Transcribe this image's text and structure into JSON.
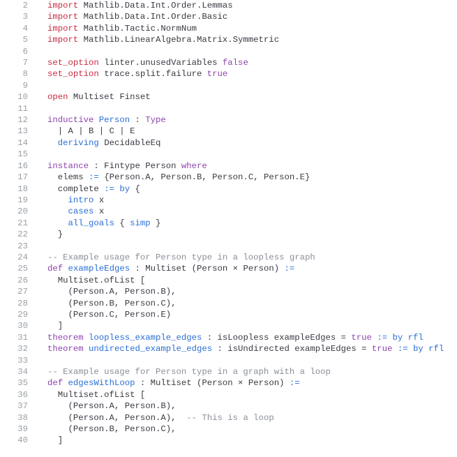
{
  "lines": [
    {
      "n": 2,
      "segs": [
        [
          "kw-import",
          "import "
        ],
        [
          "plain",
          "Mathlib.Data.Int.Order.Lemmas"
        ]
      ]
    },
    {
      "n": 3,
      "segs": [
        [
          "kw-import",
          "import "
        ],
        [
          "plain",
          "Mathlib.Data.Int.Order.Basic"
        ]
      ]
    },
    {
      "n": 4,
      "segs": [
        [
          "kw-import",
          "import "
        ],
        [
          "plain",
          "Mathlib.Tactic.NormNum"
        ]
      ]
    },
    {
      "n": 5,
      "segs": [
        [
          "kw-import",
          "import "
        ],
        [
          "plain",
          "Mathlib.LinearAlgebra.Matrix.Symmetric"
        ]
      ]
    },
    {
      "n": 6,
      "segs": [
        [
          "plain",
          ""
        ]
      ]
    },
    {
      "n": 7,
      "segs": [
        [
          "kw-import",
          "set_option "
        ],
        [
          "plain",
          "linter.unusedVariables "
        ],
        [
          "kw-purple",
          "false"
        ]
      ]
    },
    {
      "n": 8,
      "segs": [
        [
          "kw-import",
          "set_option "
        ],
        [
          "plain",
          "trace.split.failure "
        ],
        [
          "kw-purple",
          "true"
        ]
      ]
    },
    {
      "n": 9,
      "segs": [
        [
          "plain",
          ""
        ]
      ]
    },
    {
      "n": 10,
      "segs": [
        [
          "kw-import",
          "open "
        ],
        [
          "plain",
          "Multiset Finset"
        ]
      ]
    },
    {
      "n": 11,
      "segs": [
        [
          "plain",
          ""
        ]
      ]
    },
    {
      "n": 12,
      "segs": [
        [
          "kw-purple",
          "inductive "
        ],
        [
          "kw-blue",
          "Person"
        ],
        [
          "plain",
          " : "
        ],
        [
          "kw-purple",
          "Type"
        ]
      ]
    },
    {
      "n": 13,
      "segs": [
        [
          "plain",
          "  | A | B | C | E"
        ]
      ]
    },
    {
      "n": 14,
      "segs": [
        [
          "plain",
          "  "
        ],
        [
          "kw-blue",
          "deriving "
        ],
        [
          "plain",
          "DecidableEq"
        ]
      ]
    },
    {
      "n": 15,
      "segs": [
        [
          "plain",
          ""
        ]
      ]
    },
    {
      "n": 16,
      "segs": [
        [
          "kw-purple",
          "instance"
        ],
        [
          "plain",
          " : Fintype Person "
        ],
        [
          "kw-purple",
          "where"
        ]
      ]
    },
    {
      "n": 17,
      "segs": [
        [
          "plain",
          "  elems "
        ],
        [
          "kw-blue",
          ":="
        ],
        [
          "plain",
          " {Person.A, Person.B, Person.C, Person.E}"
        ]
      ]
    },
    {
      "n": 18,
      "segs": [
        [
          "plain",
          "  complete "
        ],
        [
          "kw-blue",
          ":= by"
        ],
        [
          "plain",
          " {"
        ]
      ]
    },
    {
      "n": 19,
      "segs": [
        [
          "plain",
          "    "
        ],
        [
          "kw-blue",
          "intro"
        ],
        [
          "plain",
          " x"
        ]
      ]
    },
    {
      "n": 20,
      "segs": [
        [
          "plain",
          "    "
        ],
        [
          "kw-blue",
          "cases"
        ],
        [
          "plain",
          " x"
        ]
      ]
    },
    {
      "n": 21,
      "segs": [
        [
          "plain",
          "    "
        ],
        [
          "kw-blue",
          "all_goals"
        ],
        [
          "plain",
          " { "
        ],
        [
          "kw-blue",
          "simp"
        ],
        [
          "plain",
          " }"
        ]
      ]
    },
    {
      "n": 22,
      "segs": [
        [
          "plain",
          "  }"
        ]
      ]
    },
    {
      "n": 23,
      "segs": [
        [
          "plain",
          ""
        ]
      ]
    },
    {
      "n": 24,
      "segs": [
        [
          "comment",
          "-- Example usage for Person type in a loopless graph"
        ]
      ]
    },
    {
      "n": 25,
      "segs": [
        [
          "kw-purple",
          "def "
        ],
        [
          "kw-blue",
          "exampleEdges"
        ],
        [
          "plain",
          " : Multiset (Person × Person) "
        ],
        [
          "kw-blue",
          ":="
        ]
      ]
    },
    {
      "n": 26,
      "segs": [
        [
          "plain",
          "  Multiset.ofList ["
        ]
      ]
    },
    {
      "n": 27,
      "segs": [
        [
          "plain",
          "    (Person.A, Person.B),"
        ]
      ]
    },
    {
      "n": 28,
      "segs": [
        [
          "plain",
          "    (Person.B, Person.C),"
        ]
      ]
    },
    {
      "n": 29,
      "segs": [
        [
          "plain",
          "    (Person.C, Person.E)"
        ]
      ]
    },
    {
      "n": 30,
      "segs": [
        [
          "plain",
          "  ]"
        ]
      ]
    },
    {
      "n": 31,
      "segs": [
        [
          "kw-purple",
          "theorem "
        ],
        [
          "kw-blue",
          "loopless_example_edges"
        ],
        [
          "plain",
          " : isLoopless exampleEdges = "
        ],
        [
          "kw-purple",
          "true"
        ],
        [
          "plain",
          " "
        ],
        [
          "kw-blue",
          ":= by rfl"
        ]
      ]
    },
    {
      "n": 32,
      "segs": [
        [
          "kw-purple",
          "theorem "
        ],
        [
          "kw-blue",
          "undirected_example_edges"
        ],
        [
          "plain",
          " : isUndirected exampleEdges = "
        ],
        [
          "kw-purple",
          "true"
        ],
        [
          "plain",
          " "
        ],
        [
          "kw-blue",
          ":= by rfl"
        ]
      ]
    },
    {
      "n": 33,
      "segs": [
        [
          "plain",
          ""
        ]
      ]
    },
    {
      "n": 34,
      "segs": [
        [
          "comment",
          "-- Example usage for Person type in a graph with a loop"
        ]
      ]
    },
    {
      "n": 35,
      "segs": [
        [
          "kw-purple",
          "def "
        ],
        [
          "kw-blue",
          "edgesWithLoop"
        ],
        [
          "plain",
          " : Multiset (Person × Person) "
        ],
        [
          "kw-blue",
          ":="
        ]
      ]
    },
    {
      "n": 36,
      "segs": [
        [
          "plain",
          "  Multiset.ofList ["
        ]
      ]
    },
    {
      "n": 37,
      "segs": [
        [
          "plain",
          "    (Person.A, Person.B),"
        ]
      ]
    },
    {
      "n": 38,
      "segs": [
        [
          "plain",
          "    (Person.A, Person.A),  "
        ],
        [
          "comment",
          "-- This is a loop"
        ]
      ]
    },
    {
      "n": 39,
      "segs": [
        [
          "plain",
          "    (Person.B, Person.C),"
        ]
      ]
    },
    {
      "n": 40,
      "segs": [
        [
          "plain",
          "  ]"
        ]
      ]
    }
  ]
}
